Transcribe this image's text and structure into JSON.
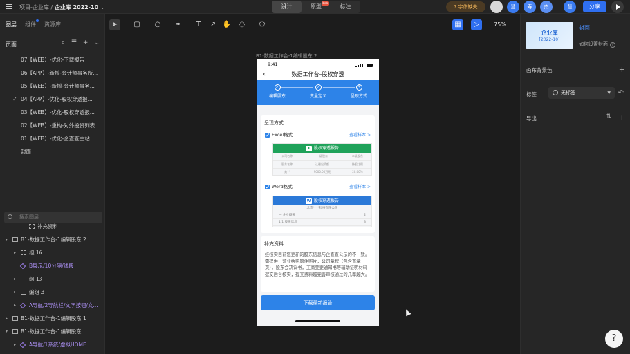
{
  "topbar": {
    "breadcrumb_project": "项目-企业库",
    "separator": "/",
    "breadcrumb_current": "企业库 2022-10",
    "dropdown_glyph": "⌄",
    "modes": [
      "设计",
      "原型",
      "标注"
    ],
    "beta_label": "beta",
    "font_missing": "字体缺失",
    "avatars": [
      {
        "label": "",
        "color": "#d8d8d8"
      },
      {
        "label": "慧",
        "color": "#3a7bf0"
      },
      {
        "label": "寿",
        "color": "#4a86f5"
      },
      {
        "label": "杰",
        "color": "#5b8ff2"
      },
      {
        "label": "慧",
        "color": "#3a7bf0"
      }
    ],
    "share": "分享"
  },
  "left_panel": {
    "tabs": [
      "图层",
      "组件",
      "资源库"
    ],
    "pages_title": "页面",
    "pages": [
      {
        "label": "07【WEB】-优化-下载报告",
        "checked": false
      },
      {
        "label": "06【APP】-新增-会计师事务所...",
        "checked": false
      },
      {
        "label": "05【WEB】-新增-会计师事务...",
        "checked": false
      },
      {
        "label": "04【APP】-优化-股权穿透报...",
        "checked": true
      },
      {
        "label": "03【WEB】-优化-股权穿透报...",
        "checked": false
      },
      {
        "label": "02【WEB】-重构-对外投资列表",
        "checked": false
      },
      {
        "label": "01【WEB】-优化-企查查主站...",
        "checked": false
      },
      {
        "label": "封面",
        "checked": false
      }
    ],
    "search_placeholder": "搜索图层...",
    "layers": [
      {
        "label": "补充资料",
        "indent": 2,
        "type": "group",
        "arrow": "",
        "purple": false
      },
      {
        "label": "B1-数据工作台-1编辑股东 2",
        "indent": 0,
        "type": "frame",
        "arrow": "▾",
        "purple": false
      },
      {
        "label": "组 16",
        "indent": 1,
        "type": "group",
        "arrow": "▸",
        "purple": false
      },
      {
        "label": "B展示/10分隔/线段",
        "indent": 1,
        "type": "comp",
        "arrow": "",
        "purple": true
      },
      {
        "label": "组 13",
        "indent": 1,
        "type": "frame",
        "arrow": "▸",
        "purple": false
      },
      {
        "label": "编组 3",
        "indent": 1,
        "type": "frame",
        "arrow": "▸",
        "purple": false
      },
      {
        "label": "A导航/2导航栏/文字按钮/文...",
        "indent": 1,
        "type": "comp",
        "arrow": "▸",
        "purple": true
      },
      {
        "label": "B1-数据工作台-1编辑股东 1",
        "indent": 0,
        "type": "frame",
        "arrow": "▸",
        "purple": false
      },
      {
        "label": "B1-数据工作台-1编辑股东",
        "indent": 0,
        "type": "frame",
        "arrow": "▾",
        "purple": false
      },
      {
        "label": "A导航/1系统/虚拟HOME",
        "indent": 1,
        "type": "comp",
        "arrow": "▸",
        "purple": true
      }
    ]
  },
  "canvas": {
    "zoom": "75%",
    "frame_label": "B1-数据工作台-1编辑股东 2"
  },
  "phone": {
    "time": "9:41",
    "nav_title": "数据工作台–股权穿透",
    "steps": [
      {
        "num": "✓",
        "label": "编辑股东"
      },
      {
        "num": "✓",
        "label": "变量定义"
      },
      {
        "num": "3",
        "label": "呈现方式"
      }
    ],
    "present_title": "呈现方式",
    "excel": {
      "label": "Excel格式",
      "link": "查看样本 >",
      "header": "股权穿透报告",
      "icon_letter": "X",
      "rows": [
        [
          "公司名称",
          "一级股东",
          "二级股东"
        ],
        [
          "股东名称",
          "认缴出资额",
          "持股比例"
        ],
        [
          "集**",
          "9000.00万元",
          "20.00%"
        ]
      ]
    },
    "word": {
      "label": "Word格式",
      "link": "查看样本 >",
      "header": "股权穿透报告",
      "icon_letter": "W",
      "company": "北京****科技有限公司",
      "lines": [
        {
          "label": "一 企业概要",
          "num": "2"
        },
        {
          "label": "1.1 股东信息",
          "num": "3"
        }
      ]
    },
    "supp_title": "补充资料",
    "supp_text": "经核实目前您更新的股东信息与企查查公示的不一致。需提供：营业执照原件照片，公司章程（包含首章页），股东会决议书，工商变更通知书等辅助证明材料提交后台核实，提交资料越完善审核通过的几率越大。",
    "download": "下载最新报告"
  },
  "right_panel": {
    "cover_title": "企业库",
    "cover_sub": "[2022-10]",
    "cover_label": "封面",
    "cover_help": "如何设置封面",
    "bg_color_label": "画布背景色",
    "tag_label": "标签",
    "tag_value": "无标签",
    "export_label": "导出",
    "help": "?"
  },
  "colors": {
    "accent": "#2f6ff0",
    "phone_blue": "#2d83e8",
    "excel_green": "#1fa25a",
    "word_blue": "#2b79d8"
  }
}
